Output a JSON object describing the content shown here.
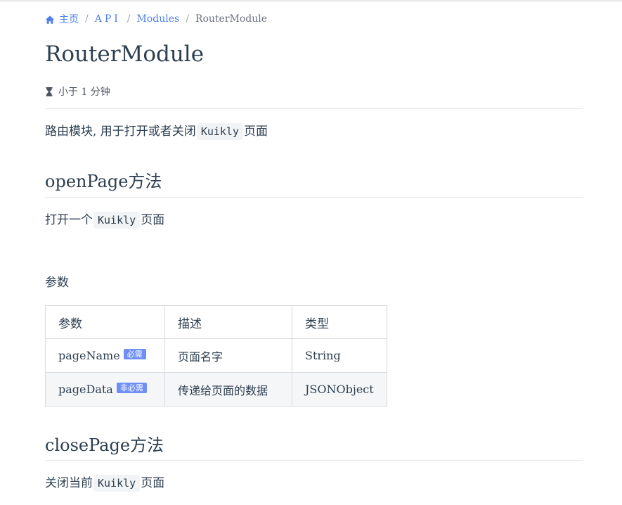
{
  "breadcrumb": {
    "home": "主页",
    "api": "API",
    "modules": "Modules",
    "current": "RouterModule",
    "separator": "/"
  },
  "page": {
    "title": "RouterModule",
    "reading_time": "小于 1 分钟"
  },
  "intro": {
    "before": "路由模块, 用于打开或者关闭",
    "code": "Kuikly",
    "after": "页面"
  },
  "open_page": {
    "heading": "openPage方法",
    "desc_before": "打开一个",
    "desc_code": "Kuikly",
    "desc_after": "页面",
    "params_heading": "参数"
  },
  "table": {
    "headers": [
      "参数",
      "描述",
      "类型"
    ],
    "rows": [
      {
        "name": "pageName",
        "badge": "必需",
        "desc": "页面名字",
        "type": "String"
      },
      {
        "name": "pageData",
        "badge": "非必需",
        "desc": "传递给页面的数据",
        "type": "JSONObject"
      }
    ]
  },
  "close_page": {
    "heading": "closePage方法",
    "desc_before": "关闭当前",
    "desc_code": "Kuikly",
    "desc_after": "页面"
  },
  "icons": {
    "home": "home-icon",
    "reading_time": "hourglass-icon"
  },
  "colors": {
    "link": "#4f7ff0",
    "badge": "#6f8ff5",
    "text": "#2c3e50"
  }
}
